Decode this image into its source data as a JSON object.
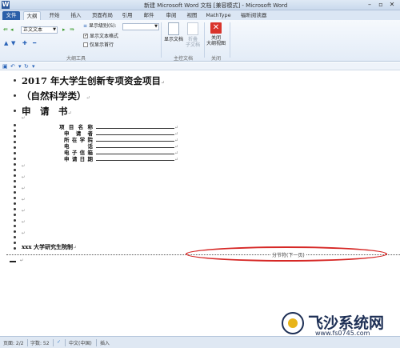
{
  "window": {
    "app_letter": "W",
    "title": "新建 Microsoft Word 文档 [兼容模式] - Microsoft Word",
    "btn_minimize": "–",
    "btn_restore": "▫",
    "btn_close": "✕"
  },
  "tabs": {
    "file": "文件",
    "outline": "大纲",
    "home": "开始",
    "insert": "插入",
    "layout": "页面布局",
    "references": "引用",
    "mailings": "邮件",
    "review": "审阅",
    "view": "视图",
    "mathtype": "MathType",
    "reader": "福昕阅读器"
  },
  "ribbon": {
    "level_dropdown": "正文文本",
    "show_level_label": "显示级别(S):",
    "show_text_format": "显示文本格式",
    "first_line_only": "仅显示首行",
    "show_document": "显示文档",
    "collapse_sub": "折叠\n子文档",
    "close_outline": "关闭\n大纲视图",
    "group_outline_tools": "大纲工具",
    "group_master_doc": "主控文档",
    "group_close": "关闭"
  },
  "document": {
    "line1": "2017 年大学生创新专项资金项目",
    "line2": "（自然科学类）",
    "line3": "申　请　书",
    "para_mark": "↵",
    "form": [
      {
        "label": "项目名称"
      },
      {
        "label": "申请者"
      },
      {
        "label": "所在学院"
      },
      {
        "label": "电话"
      },
      {
        "label": "电子信箱"
      },
      {
        "label": "申请日期"
      }
    ],
    "footer": "xxx 大学研究生院制",
    "section_break": "分节符(下一页)"
  },
  "status": {
    "page": "页面: 2/2",
    "words": "字数: 52",
    "lang": "中文(中国)",
    "mode": "插入"
  },
  "watermark": {
    "brand": "飞沙系统网",
    "url": "www.fs0745.com"
  },
  "colors": {
    "accent": "#2b5fa8",
    "annotation_red": "#d62826"
  }
}
